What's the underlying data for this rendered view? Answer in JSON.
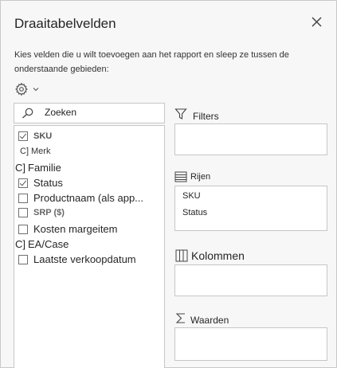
{
  "pane": {
    "title": "Draaitabelvelden",
    "instructions": "Kies velden die u wilt toevoegen aan het rapport en sleep ze tussen de onderstaande gebieden:"
  },
  "search": {
    "placeholder": "Zoeken",
    "value": ""
  },
  "fields": [
    {
      "label": "SKU",
      "checked": true,
      "bold": true
    },
    {
      "label": "Merk",
      "checked": false,
      "prefix": "C]"
    },
    {
      "label": "Familie",
      "checked": false,
      "prefix": "C]"
    },
    {
      "label": "Status",
      "checked": true
    },
    {
      "label": "Productnaam (als app...",
      "checked": false
    },
    {
      "label": "SRP ($)",
      "checked": false,
      "bold": true
    },
    {
      "label": "Kosten margeitem",
      "checked": false
    },
    {
      "label": "EA/Case",
      "checked": false,
      "prefix": "C]"
    },
    {
      "label": "Laatste verkoopdatum",
      "checked": false
    }
  ],
  "areas": {
    "filters": {
      "label": "Filters",
      "items": []
    },
    "rows": {
      "label": "Rijen",
      "items": [
        "SKU",
        "Status"
      ]
    },
    "columns": {
      "label": "Kolommen",
      "items": []
    },
    "values": {
      "label": "Waarden",
      "items": []
    }
  },
  "icons": {
    "close": "close-icon",
    "gear": "gear-icon",
    "search": "search-icon",
    "filter": "filter-icon",
    "rows": "rows-icon",
    "columns": "columns-icon",
    "values": "sigma-icon"
  }
}
